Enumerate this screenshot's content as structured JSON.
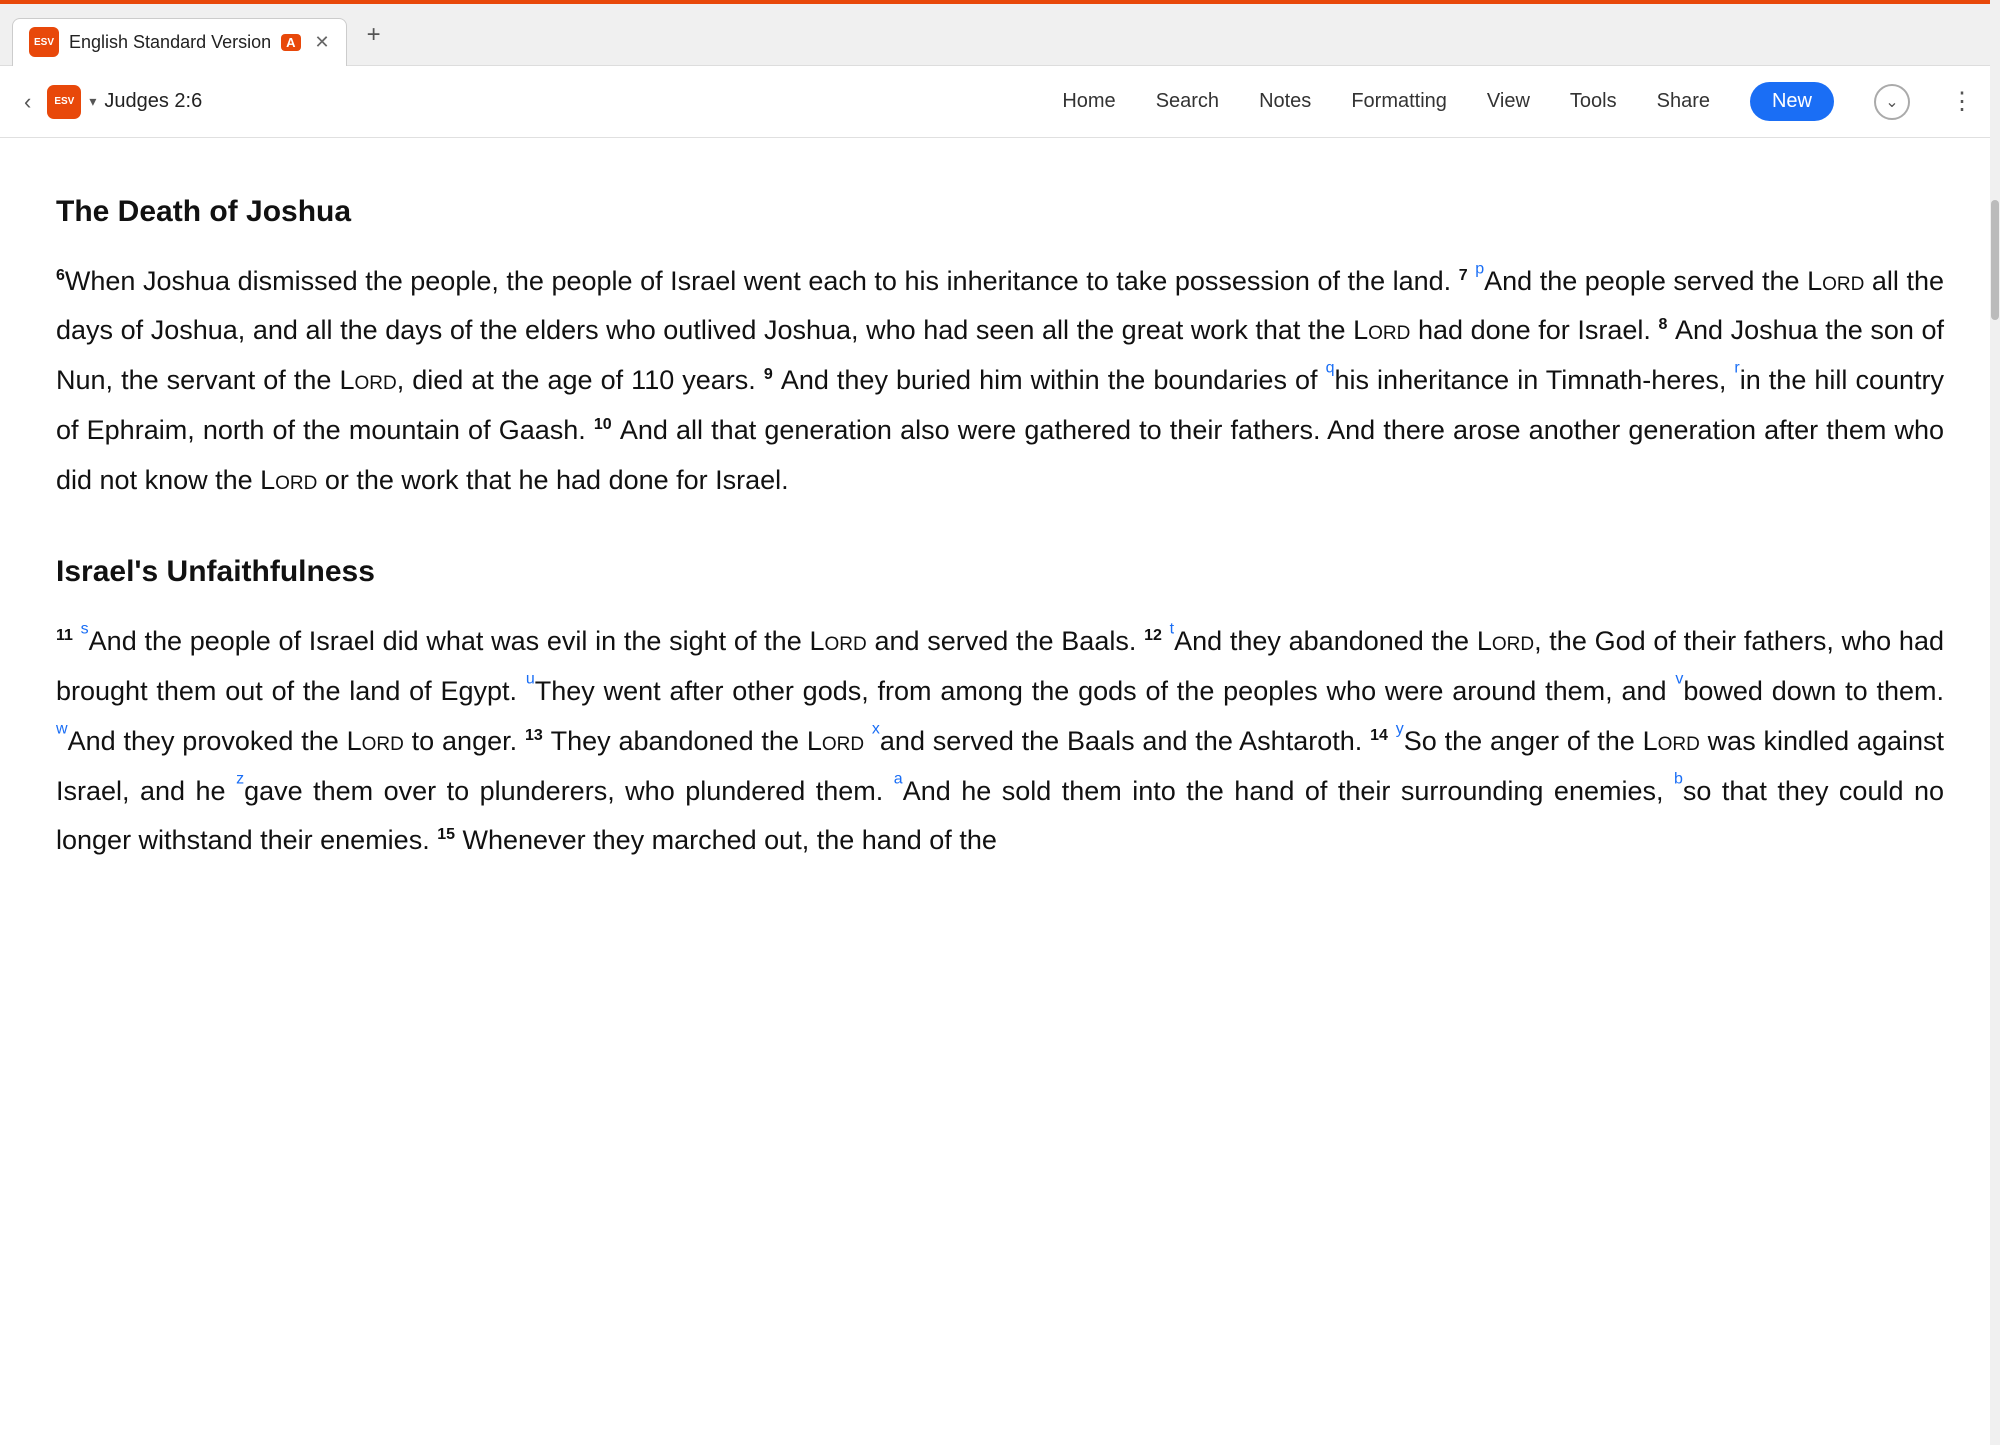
{
  "browser": {
    "loading_bar_color": "#e8480a"
  },
  "tab": {
    "icon_letter": "ESV",
    "title": "English Standard Version",
    "badge": "A",
    "close_icon": "✕",
    "add_icon": "+"
  },
  "navbar": {
    "back_icon": "‹",
    "location_icon_text": "ESV",
    "location_caret": "∨",
    "location_text": "Judges 2:6",
    "menu_items": [
      "Home",
      "Search",
      "Notes",
      "Formatting",
      "View",
      "Tools",
      "Share"
    ],
    "new_button": "New",
    "circle_icon": "⌄",
    "dots_icon": "⋮"
  },
  "content": {
    "section1_heading": "The Death of Joshua",
    "section2_heading": "Israel's Unfaithfulness",
    "verse6": "6",
    "verse7_ref": "7",
    "fn_p": "p",
    "verse8": "8",
    "verse9": "9",
    "fn_q": "q",
    "fn_r": "r",
    "verse10": "10",
    "verse11": "11",
    "fn_s": "s",
    "verse12": "12",
    "fn_t": "t",
    "fn_u": "u",
    "fn_v": "v",
    "fn_w": "w",
    "verse13": "13",
    "fn_x": "x",
    "verse14": "14",
    "fn_y": "y",
    "fn_z": "z",
    "fn_a": "a",
    "fn_b": "b",
    "verse15_num": "15",
    "para1": "When Joshua dismissed the people, the people of Israel went each to his inheritance to take possession of the land.",
    "para1b": "And the people served the",
    "para1c": "LORD",
    "para1d": "all the days of Joshua, and all the days of the elders who outlived Joshua, who had seen all the great work that the",
    "para1e": "LORD",
    "para1f": "had done for Israel.",
    "para2a": "And Joshua the son of Nun, the servant of the",
    "para2b": "LORD",
    "para2c": ", died at the age of 110 years.",
    "para2d": "And they buried him within the boundaries of",
    "para2e": "his inheritance in Timnath-heres,",
    "para2f": "in the hill country of Ephraim, north of the mountain of Gaash.",
    "para3a": "And all that generation also were gathered to their fathers. And there arose another generation after them who did not know the",
    "para3b": "LORD",
    "para3c": "or the work that he had done for Israel.",
    "para4a": "And the people of Israel did what was evil in the sight of the",
    "para4b": "LORD",
    "para4c": "and served the Baals.",
    "para4d": "And they abandoned the",
    "para4e": "LORD",
    "para4f": ", the God of their fathers, who had brought them out of the land of Egypt.",
    "para4g": "They went after other gods, from among the gods of the peoples who were around them, and",
    "para4h": "bowed down to them.",
    "para4i": "And they provoked the",
    "para4j": "LORD",
    "para4k": "to anger.",
    "para5a": "They abandoned the",
    "para5b": "LORD",
    "para5c": "and served the Baals and the Ashtaroth.",
    "para5d": "So the anger of the",
    "para5e": "LORD",
    "para5f": "was kindled against Israel, and he",
    "para5g": "gave them over to plunderers, who plundered them.",
    "para5h": "And he sold them into the hand of their surrounding enemies,",
    "para5i": "so that they could no longer withstand their enemies.",
    "para5j": "Whenever they marched out, the hand of the"
  }
}
